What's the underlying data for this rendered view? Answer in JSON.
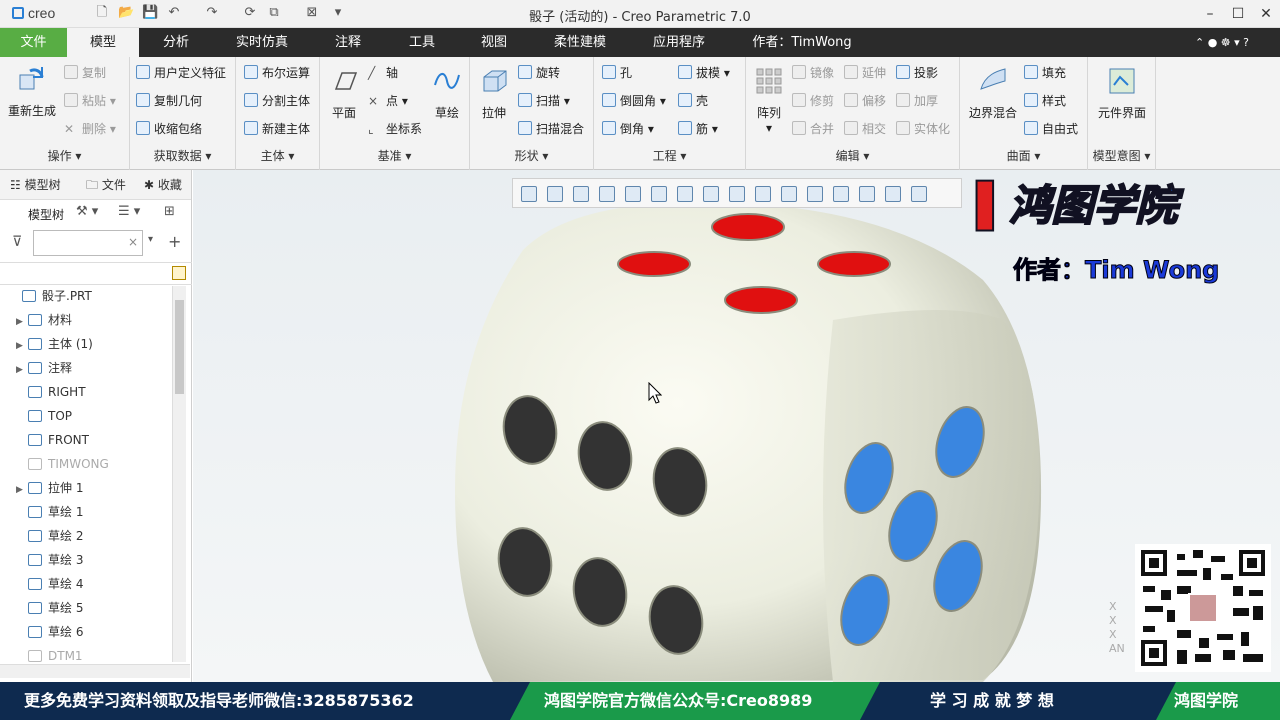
{
  "titlebar": {
    "app_logo": "creo",
    "title": "骰子 (活动的) - Creo Parametric 7.0"
  },
  "menu": {
    "tabs": [
      "文件",
      "模型",
      "分析",
      "实时仿真",
      "注释",
      "工具",
      "视图",
      "柔性建模",
      "应用程序"
    ],
    "author": "作者：TimWong"
  },
  "ribbon": {
    "ops": {
      "regen": "重新生成",
      "copy": "复制",
      "paste": "粘贴",
      "delete": "删除",
      "label": "操作"
    },
    "getdata": {
      "udf": "用户定义特征",
      "copygeom": "复制几何",
      "shrink": "收缩包络",
      "label": "获取数据"
    },
    "body": {
      "bool": "布尔运算",
      "split": "分割主体",
      "newbody": "新建主体",
      "label": "主体"
    },
    "datum": {
      "plane": "平面",
      "axis": "轴",
      "point": "点",
      "csys": "坐标系",
      "sketch": "草绘",
      "label": "基准"
    },
    "shape": {
      "extrude": "拉伸",
      "revolve": "旋转",
      "sweep": "扫描",
      "sweepblend": "扫描混合",
      "label": "形状"
    },
    "eng": {
      "hole": "孔",
      "round": "倒圆角",
      "chamfer": "倒角",
      "draft": "拔模",
      "shell": "壳",
      "rib": "筋",
      "label": "工程"
    },
    "edit": {
      "pattern": "阵列",
      "mirror": "镜像",
      "extend": "延伸",
      "project": "投影",
      "trim": "修剪",
      "offset": "偏移",
      "thicken": "加厚",
      "merge": "合并",
      "intersect": "相交",
      "solidify": "实体化",
      "label": "编辑"
    },
    "surface": {
      "boundary": "边界混合",
      "fill": "填充",
      "style": "样式",
      "freestyle": "自由式",
      "label": "曲面"
    },
    "intent": {
      "component": "元件界面",
      "label": "模型意图"
    }
  },
  "panel": {
    "tabs": [
      "模型树",
      "文件",
      "收藏"
    ],
    "tree_label": "模型树",
    "items": [
      {
        "label": "骰子.PRT",
        "level": 0,
        "exp": false,
        "muted": false
      },
      {
        "label": "材料",
        "level": 1,
        "exp": true,
        "muted": false
      },
      {
        "label": "主体 (1)",
        "level": 1,
        "exp": true,
        "muted": false
      },
      {
        "label": "注释",
        "level": 1,
        "exp": true,
        "muted": false
      },
      {
        "label": "RIGHT",
        "level": 1,
        "exp": false,
        "muted": false
      },
      {
        "label": "TOP",
        "level": 1,
        "exp": false,
        "muted": false
      },
      {
        "label": "FRONT",
        "level": 1,
        "exp": false,
        "muted": false
      },
      {
        "label": "TIMWONG",
        "level": 1,
        "exp": false,
        "muted": true
      },
      {
        "label": "拉伸 1",
        "level": 1,
        "exp": true,
        "muted": false
      },
      {
        "label": "草绘 1",
        "level": 1,
        "exp": false,
        "muted": false
      },
      {
        "label": "草绘 2",
        "level": 1,
        "exp": false,
        "muted": false
      },
      {
        "label": "草绘 3",
        "level": 1,
        "exp": false,
        "muted": false
      },
      {
        "label": "草绘 4",
        "level": 1,
        "exp": false,
        "muted": false
      },
      {
        "label": "草绘 5",
        "level": 1,
        "exp": false,
        "muted": false
      },
      {
        "label": "草绘 6",
        "level": 1,
        "exp": false,
        "muted": false
      },
      {
        "label": "DTM1",
        "level": 1,
        "exp": false,
        "muted": true
      }
    ]
  },
  "watermark": {
    "brand": "鸿图学院",
    "author": "作者：Tim Wong"
  },
  "bottom": {
    "left": "更多免费学习资料领取及指导老师微信:3285875362",
    "mid": "鸿图学院官方微信公众号:Creo8989",
    "right": "学 习 成 就 梦 想",
    "brand": "鸿图学院"
  },
  "colors": {
    "file_tab": "#58ad44",
    "menubar": "#2b2b2b",
    "die_top": "#e01010",
    "die_front": "#333333",
    "die_side": "#3a86e0",
    "bottom_bar": "#0e2a4f",
    "bottom_green": "#1a9a4a"
  }
}
